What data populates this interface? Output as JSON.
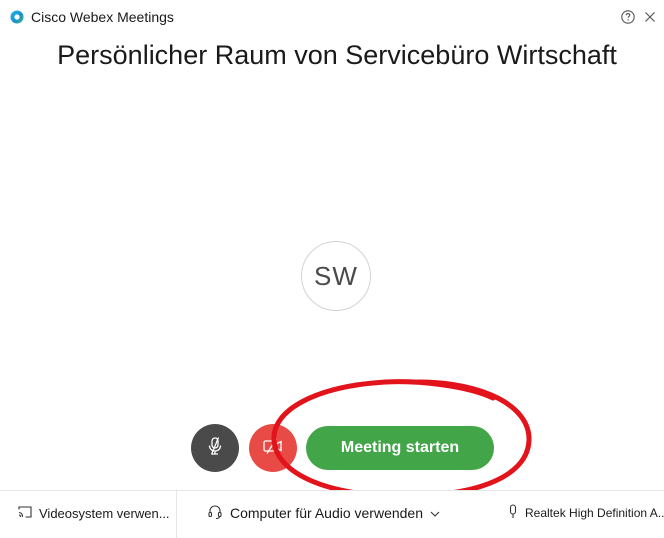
{
  "window": {
    "app_title": "Cisco Webex Meetings",
    "logo_icon": "webex-logo-icon",
    "help_icon": "help-icon",
    "close_icon": "close-icon"
  },
  "room": {
    "title": "Persönlicher Raum von Servicebüro Wirtschaft",
    "avatar_initials": "SW"
  },
  "controls": {
    "mute_icon": "microphone-muted-icon",
    "video_icon": "video-off-icon",
    "start_label": "Meeting starten"
  },
  "bottombar": {
    "video_system_label": "Videosystem verwen...",
    "audio_label": "Computer für Audio verwenden",
    "microphone_label": "Realtek High Definition A..."
  },
  "colors": {
    "start_button": "#42a548",
    "mute_button": "#4a4a4a",
    "video_button": "#e84a45",
    "annotation": "#e3131b"
  }
}
